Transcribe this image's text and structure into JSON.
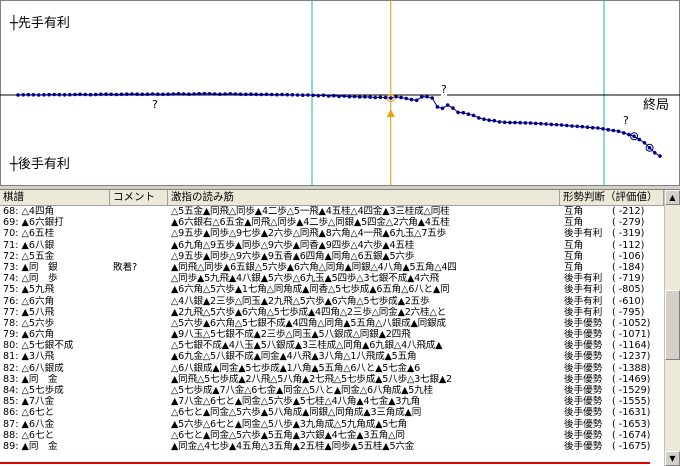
{
  "graph": {
    "label_top": "┼先手有利",
    "label_bottom": "┼後手有利",
    "label_end": "終局",
    "question_marks": [
      "?",
      "?",
      "?"
    ],
    "colors": {
      "line": "#00008b",
      "axis": "#000000",
      "cursor": "#d4a000",
      "vline": "#20b2aa",
      "border": "#808080"
    }
  },
  "chart_data": {
    "type": "line",
    "x": [
      1,
      2,
      3,
      4,
      5,
      6,
      7,
      8,
      9,
      10,
      11,
      12,
      13,
      14,
      15,
      16,
      17,
      18,
      19,
      20,
      21,
      22,
      23,
      24,
      25,
      26,
      27,
      28,
      29,
      30,
      31,
      32,
      33,
      34,
      35,
      36,
      37,
      38,
      39,
      40,
      41,
      42,
      43,
      44,
      45,
      46,
      47,
      48,
      49,
      50,
      51,
      52,
      53,
      54,
      55,
      56,
      57,
      58,
      59,
      60,
      61,
      62,
      63,
      64,
      65,
      66,
      67,
      68,
      69,
      70,
      71,
      72,
      73,
      74,
      75,
      76,
      77,
      78,
      79,
      80,
      81,
      82,
      83,
      84,
      85,
      86,
      87,
      88,
      89,
      90,
      91,
      92,
      93,
      94,
      95,
      96,
      97,
      98,
      99,
      100,
      101,
      102,
      103,
      104,
      105,
      106,
      107,
      108,
      109,
      110,
      111,
      112,
      113,
      114,
      115,
      116,
      117,
      118,
      119,
      120,
      121,
      122,
      123,
      124,
      125
    ],
    "series": [
      {
        "values": [
          0,
          10,
          20,
          10,
          0,
          10,
          20,
          30,
          20,
          10,
          20,
          30,
          40,
          30,
          20,
          30,
          40,
          50,
          40,
          30,
          40,
          50,
          60,
          50,
          40,
          50,
          60,
          50,
          40,
          50,
          60,
          70,
          60,
          50,
          60,
          70,
          80,
          70,
          60,
          50,
          60,
          70,
          60,
          50,
          40,
          50,
          40,
          30,
          40,
          30,
          20,
          30,
          20,
          10,
          0,
          -10,
          0,
          -20,
          -40,
          -20,
          -60,
          -40,
          -80,
          -60,
          -100,
          -90,
          -120,
          -110,
          -130,
          -150,
          -140,
          -160,
          -180,
          -100,
          -150,
          -212,
          -279,
          -319,
          -112,
          -106,
          -184,
          -719,
          -805,
          -610,
          -795,
          -1052,
          -1071,
          -1164,
          -1237,
          -1388,
          -1469,
          -1529,
          -1555,
          -1631,
          -1653,
          -1674,
          -1675,
          -1680,
          -1690,
          -1700,
          -1720,
          -1740,
          -1760,
          -1780,
          -1800,
          -1820,
          -1850,
          -1880,
          -1900,
          -1920,
          -1950,
          -1980,
          -2000,
          -2050,
          -2100,
          -2150,
          -2200,
          -2300,
          -2400,
          -2500,
          -2700,
          -2900,
          -3200,
          -3500,
          -3700
        ]
      }
    ],
    "current_move": 73,
    "title": "",
    "xlabel": "",
    "ylabel": ""
  },
  "list": {
    "headers": {
      "move": "棋譜",
      "comment": "コメント",
      "pv": "激指の読み筋",
      "judge": "形勢判断（評価値）"
    },
    "rows": [
      {
        "move": "68: △4四角",
        "comment": "",
        "pv": "△5五金▲同飛△同歩▲4二歩△5一飛▲4五桂△4四金▲3三桂成△同桂",
        "judge": "互角",
        "eval": "(  -212)"
      },
      {
        "move": "69: ▲6六銀打",
        "comment": "",
        "pv": "▲6六銀右△6五金▲同飛△同歩▲4二歩△同銀▲5四金△2六角▲4五桂",
        "judge": "互角",
        "eval": "(  -279)"
      },
      {
        "move": "70: △6五桂",
        "comment": "",
        "pv": "△9五歩▲同歩△9七歩▲2六歩△同飛▲8六角△4一飛▲6九玉△7五歩",
        "judge": "後手有利",
        "eval": "(  -319)"
      },
      {
        "move": "71: ▲6八銀",
        "comment": "",
        "pv": "▲6九角△9五歩▲同歩△9六歩▲同香▲9四歩△4六歩▲4五桂",
        "judge": "互角",
        "eval": "(  -112)"
      },
      {
        "move": "72: △5五金",
        "comment": "",
        "pv": "△9五歩▲同歩△9六歩▲9五香▲6四角▲同角△6五銀▲5六歩",
        "judge": "互角",
        "eval": "(  -106)"
      },
      {
        "move": "73: ▲同　銀",
        "comment": "敗着?",
        "pv": "▲同飛△同歩▲6五銀△5六歩▲6六角△同角▲同銀△4八角▲5五角△4四",
        "judge": "互角",
        "eval": "(  -184)"
      },
      {
        "move": "74: △同　歩",
        "comment": "",
        "pv": "△同歩▲5九飛▲4八銀▲5六歩△6九玉▲5四歩△3七銀不成▲4六飛",
        "judge": "後手有利",
        "eval": "(  -719)"
      },
      {
        "move": "75: ▲5九飛",
        "comment": "",
        "pv": "▲6六角△5六歩▲1七角△同角成▲同香△5七歩成▲6五角△6八と▲同",
        "judge": "後手有利",
        "eval": "(  -805)"
      },
      {
        "move": "76: △6六角",
        "comment": "",
        "pv": "△4八銀▲2三歩△同玉▲2九飛△5六歩▲6六角△5七歩成▲2五歩",
        "judge": "後手有利",
        "eval": "(  -610)"
      },
      {
        "move": "77: ▲5八飛",
        "comment": "",
        "pv": "▲2九飛△5六歩▲6六角△5七歩成▲4四角△2三歩△同金▲2六桂△と",
        "judge": "後手有利",
        "eval": "(  -795)"
      },
      {
        "move": "78: △5六歩",
        "comment": "",
        "pv": "△5六歩▲6六角△5七銀不成▲4四角△同角▲5五角△八銀成▲同銀成",
        "judge": "後手優勢",
        "eval": "( -1052)"
      },
      {
        "move": "79: ▲6六角",
        "comment": "",
        "pv": "▲9八玉△5七銀不成▲2三歩△同玉▲5八銀成△同銀▲2四飛",
        "judge": "後手優勢",
        "eval": "( -1071)"
      },
      {
        "move": "80: △5七銀不成",
        "comment": "",
        "pv": "△5七銀不成▲4八玉▲5八銀成▲3三桂成△同角▲6九銀△4八飛成▲",
        "judge": "後手優勢",
        "eval": "( -1164)"
      },
      {
        "move": "81: ▲3八飛",
        "comment": "",
        "pv": "▲6九金△5八銀不成▲同金▲4八飛▲3八角△1八飛成▲5五角",
        "judge": "後手優勢",
        "eval": "( -1237)"
      },
      {
        "move": "82: △6八銀成",
        "comment": "",
        "pv": "△6八銀成▲同金▲5七歩成▲1八角▲5五角△6八と▲5七金▲6",
        "judge": "後手優勢",
        "eval": "( -1388)"
      },
      {
        "move": "83: ▲同　金",
        "comment": "",
        "pv": "▲同飛△5七歩成▲2八飛△5八角▲2七飛△5七歩成▲5八歩△3七銀▲2",
        "judge": "後手優勢",
        "eval": "( -1469)"
      },
      {
        "move": "84: △5七歩成",
        "comment": "",
        "pv": "△5七歩成▲7八金△6七金▲同金△5八と▲同金△6八角成▲5九桂",
        "judge": "後手優勢",
        "eval": "( -1529)"
      },
      {
        "move": "85: ▲7八金",
        "comment": "",
        "pv": "▲7八金△6七と▲同金△5六歩▲5七桂△4八角▲4七金▲3九角",
        "judge": "後手優勢",
        "eval": "( -1555)"
      },
      {
        "move": "86: △6七と",
        "comment": "",
        "pv": "△6七と▲同金△5六歩▲5八角成▲同銀△同角成▲3三角成▲同",
        "judge": "後手優勢",
        "eval": "( -1631)"
      },
      {
        "move": "87: ▲6八金",
        "comment": "",
        "pv": "▲5六歩△6七と▲同金△5八歩▲3九角成△5九角成▲5七角",
        "judge": "後手優勢",
        "eval": "( -1653)"
      },
      {
        "move": "88: △6七と",
        "comment": "",
        "pv": "△6七と▲同金△5六歩▲5五角▲3六銀▲4七金▲3五角△同",
        "judge": "後手優勢",
        "eval": "( -1674)"
      },
      {
        "move": "89: ▲同　金",
        "comment": "",
        "pv": "▲同金△4七歩▲4五角△3五角▲2五桂▲同歩▲5五桂▲5六金",
        "judge": "後手優勢",
        "eval": "( -1675)"
      }
    ]
  },
  "scrollbar": {
    "up": "▲",
    "down": "▼"
  }
}
